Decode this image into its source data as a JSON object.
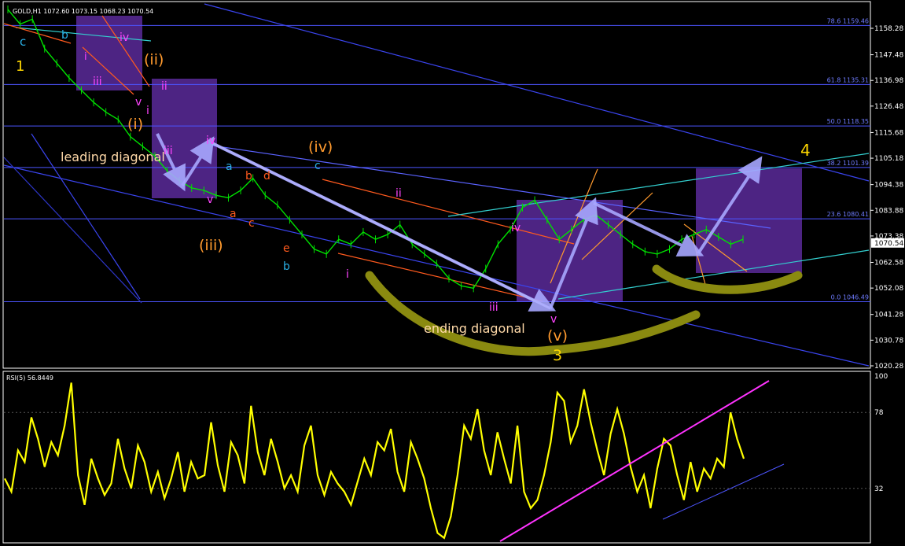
{
  "window": {
    "symbol_info": "GOLD,H1  1072.60 1073.15 1068.23 1070.54",
    "rsi_info": "RSI(5) 56.8449"
  },
  "colors": {
    "background": "#000000",
    "candles": "#00e000",
    "fib_lines": "#4d55ff",
    "rsi_line": "#ffff00",
    "rsi_trend": "#ff33ff",
    "annotation_box": "#5a2a9a",
    "arrow": "#a7a7ff",
    "olive_curve": "#8a8a10"
  },
  "annotations": {
    "leading": "leading diagonal",
    "ending": "ending diagonal"
  },
  "chart_data": [
    {
      "type": "line",
      "title": "GOLD,H1",
      "price_axis_ticks": [
        1158.28,
        1147.48,
        1136.98,
        1126.48,
        1115.68,
        1105.18,
        1094.38,
        1083.88,
        1073.38,
        1070.54,
        1062.58,
        1052.08,
        1041.28,
        1030.78,
        1020.28
      ],
      "current_price": 1070.54,
      "fibonacci_levels": [
        {
          "label": "78.6",
          "value": 1159.46
        },
        {
          "label": "61.8",
          "value": 1135.31
        },
        {
          "label": "50.0",
          "value": 1118.35
        },
        {
          "label": "38.2",
          "value": 1101.39
        },
        {
          "label": "23.6",
          "value": 1080.41
        },
        {
          "label": "0.0",
          "value": 1046.49
        }
      ],
      "price_path": [
        1166,
        1160,
        1162,
        1150,
        1144,
        1138,
        1133,
        1128,
        1124,
        1121,
        1114,
        1110,
        1106,
        1100,
        1096,
        1093,
        1092,
        1090,
        1089,
        1092,
        1097,
        1090,
        1086,
        1080,
        1074,
        1068,
        1066,
        1072,
        1070,
        1075,
        1072,
        1074,
        1078,
        1070,
        1066,
        1062,
        1056,
        1053,
        1052,
        1060,
        1070,
        1076,
        1085,
        1088,
        1080,
        1072,
        1076,
        1080,
        1082,
        1078,
        1074,
        1070,
        1067,
        1066,
        1068,
        1072,
        1074,
        1076,
        1073,
        1070,
        1072
      ],
      "wave_labels": [
        {
          "text": "1",
          "color": "#ffd700"
        },
        {
          "text": "c",
          "color": "#2ab0e6"
        },
        {
          "text": "b",
          "color": "#2ab0e6"
        },
        {
          "text": "i",
          "color": "#ff44ff"
        },
        {
          "text": "iii",
          "color": "#ff44ff"
        },
        {
          "text": "iv",
          "color": "#ff44ff"
        },
        {
          "text": "v",
          "color": "#ff44ff"
        },
        {
          "text": "(ii)",
          "color": "#ff9a2e"
        },
        {
          "text": "ii",
          "color": "#ff44ff"
        },
        {
          "text": "i",
          "color": "#ff44ff"
        },
        {
          "text": "(i)",
          "color": "#ff9a2e"
        },
        {
          "text": "iii",
          "color": "#ff44ff"
        },
        {
          "text": "iv",
          "color": "#ff44ff"
        },
        {
          "text": "v",
          "color": "#ff44ff"
        },
        {
          "text": "(iii)",
          "color": "#ff9a2e"
        },
        {
          "text": "a",
          "color": "#2ab0e6"
        },
        {
          "text": "b",
          "color": "#ff5a1e"
        },
        {
          "text": "d",
          "color": "#ff5a1e"
        },
        {
          "text": "a",
          "color": "#ff5a1e"
        },
        {
          "text": "c",
          "color": "#ff5a1e"
        },
        {
          "text": "(iv)",
          "color": "#ff9a2e"
        },
        {
          "text": "c",
          "color": "#2ab0e6"
        },
        {
          "text": "e",
          "color": "#ff5a1e"
        },
        {
          "text": "b",
          "color": "#2ab0e6"
        },
        {
          "text": "i",
          "color": "#ff44ff"
        },
        {
          "text": "ii",
          "color": "#ff44ff"
        },
        {
          "text": "iv",
          "color": "#ff44ff"
        },
        {
          "text": "iii",
          "color": "#ff44ff"
        },
        {
          "text": "v",
          "color": "#ff44ff"
        },
        {
          "text": "(v)",
          "color": "#ff9a2e"
        },
        {
          "text": "3",
          "color": "#ffd700"
        },
        {
          "text": "4",
          "color": "#ffd700"
        }
      ]
    },
    {
      "type": "line",
      "title": "RSI(5) 56.8449",
      "ylim": [
        0,
        100
      ],
      "ticks": [
        100,
        78,
        32
      ],
      "levels": [
        78,
        32
      ],
      "values": [
        38,
        30,
        55,
        48,
        75,
        62,
        45,
        60,
        52,
        70,
        96,
        40,
        22,
        50,
        38,
        28,
        35,
        62,
        44,
        32,
        58,
        48,
        30,
        42,
        26,
        38,
        54,
        30,
        48,
        38,
        40,
        72,
        46,
        30,
        60,
        52,
        35,
        82,
        54,
        40,
        62,
        48,
        32,
        40,
        30,
        58,
        70,
        40,
        28,
        42,
        35,
        30,
        22,
        36,
        50,
        40,
        60,
        55,
        68,
        42,
        30,
        60,
        50,
        38,
        20,
        5,
        2,
        15,
        40,
        70,
        62,
        80,
        55,
        40,
        66,
        50,
        35,
        70,
        30,
        20,
        25,
        40,
        60,
        90,
        85,
        60,
        70,
        92,
        72,
        55,
        40,
        65,
        80,
        65,
        45,
        30,
        40,
        20,
        44,
        62,
        58,
        40,
        25,
        48,
        30,
        44,
        38,
        50,
        45,
        78,
        62,
        50
      ]
    }
  ]
}
